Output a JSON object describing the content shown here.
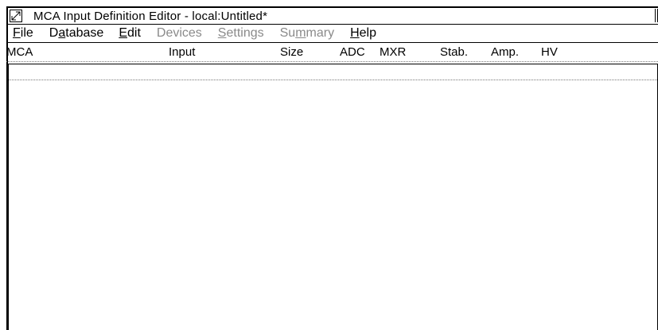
{
  "window": {
    "title": "MCA Input Definition Editor - local:Untitled*"
  },
  "menu": [
    {
      "pre": "",
      "u": "F",
      "post": "ile",
      "enabled": true
    },
    {
      "pre": "D",
      "u": "a",
      "post": "tabase",
      "enabled": true
    },
    {
      "pre": "",
      "u": "E",
      "post": "dit",
      "enabled": true
    },
    {
      "pre": "",
      "u": "",
      "post": "Devices",
      "enabled": false
    },
    {
      "pre": "",
      "u": "S",
      "post": "ettings",
      "enabled": false
    },
    {
      "pre": "Su",
      "u": "m",
      "post": "mary",
      "enabled": false
    },
    {
      "pre": "",
      "u": "H",
      "post": "elp",
      "enabled": true
    }
  ],
  "columns": [
    "MCA",
    "Input",
    "Size",
    "ADC",
    "MXR",
    "Stab.",
    "Amp.",
    "HV"
  ],
  "colors": {
    "disabled": "#8a8a8a",
    "border": "#000000"
  }
}
